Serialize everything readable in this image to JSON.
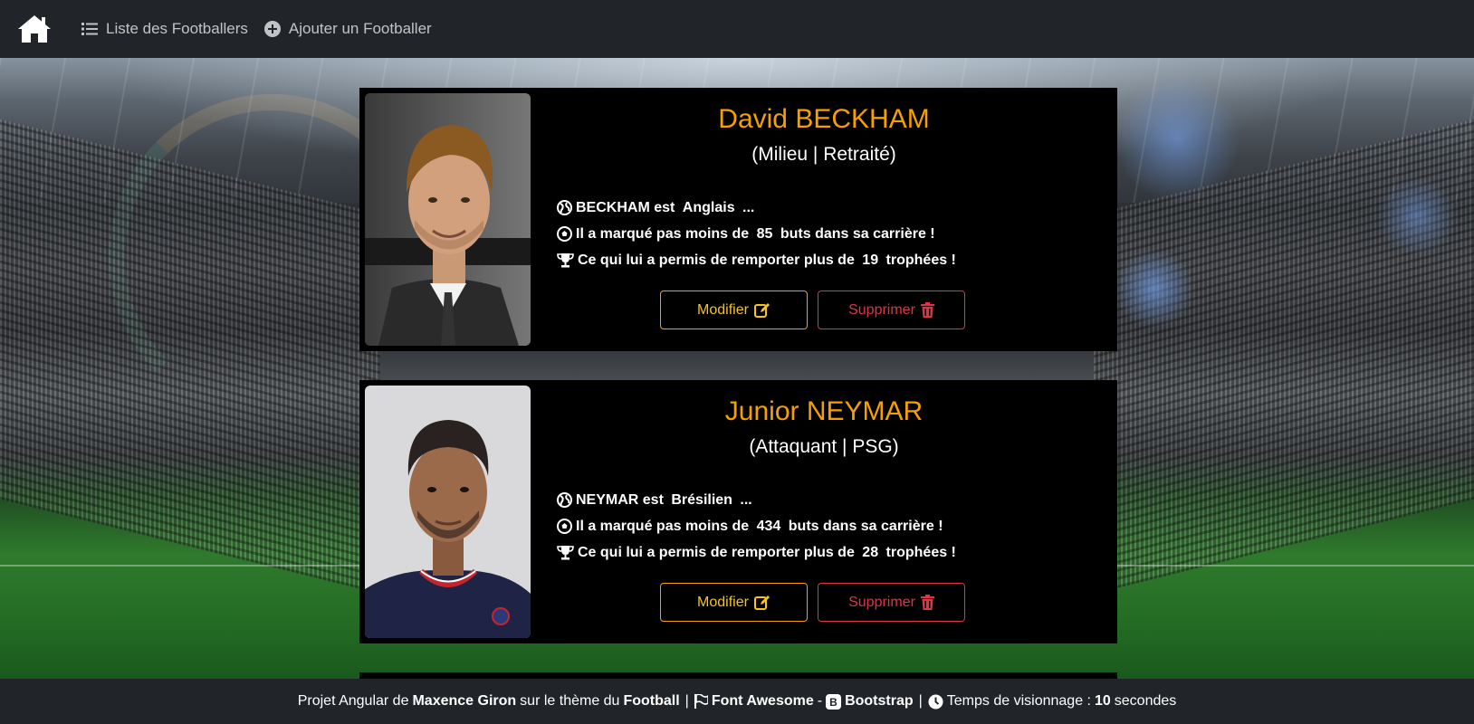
{
  "nav": {
    "home_icon": "home-icon",
    "links": [
      {
        "icon": "list-icon",
        "label": "Liste des Footballers"
      },
      {
        "icon": "plus-circle-icon",
        "label": "Ajouter un Footballer"
      }
    ]
  },
  "players": [
    {
      "name": "David BECKHAM",
      "role": "(Milieu | Retraité)",
      "fact1_pre": "BECKHAM est ",
      "fact1_bold": "Anglais",
      "fact1_post": " ...",
      "fact2_pre": "Il a marqué pas moins de ",
      "fact2_bold": "85",
      "fact2_post": " buts dans sa carrière !",
      "fact3_pre": "Ce qui lui a permis de remporter plus de ",
      "fact3_bold": "19",
      "fact3_post": " trophées !",
      "edit_label": "Modifier",
      "delete_label": "Supprimer"
    },
    {
      "name": "Junior NEYMAR",
      "role": "(Attaquant | PSG)",
      "fact1_pre": "NEYMAR est ",
      "fact1_bold": "Brésilien",
      "fact1_post": " ...",
      "fact2_pre": "Il a marqué pas moins de ",
      "fact2_bold": "434",
      "fact2_post": " buts dans sa carrière !",
      "fact3_pre": "Ce qui lui a permis de remporter plus de ",
      "fact3_bold": "28",
      "fact3_post": " trophées !",
      "edit_label": "Modifier",
      "delete_label": "Supprimer"
    }
  ],
  "footer": {
    "t1": "Projet Angular de",
    "author": "Maxence Giron",
    "t2": "sur le thème du",
    "theme": "Football",
    "sep1": "|",
    "fa": "Font Awesome",
    "dash": "-",
    "bs": "Bootstrap",
    "sep2": "|",
    "t3": "Temps de visionnage :",
    "seconds": "10",
    "t4": "secondes"
  },
  "colors": {
    "accent": "#f5a000",
    "danger": "#dc3545",
    "navbar": "#212529"
  }
}
